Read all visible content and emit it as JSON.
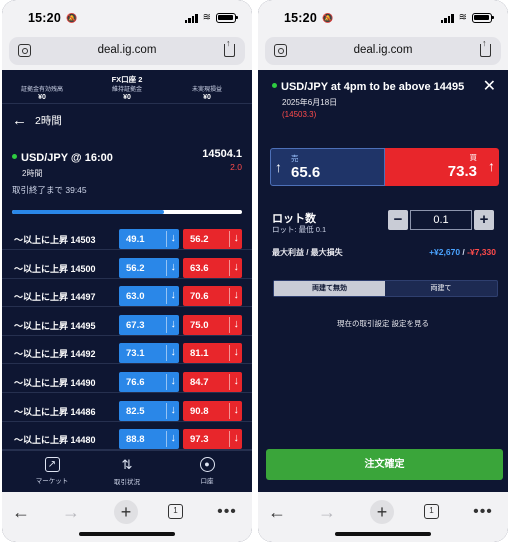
{
  "status": {
    "time": "15:20"
  },
  "browser": {
    "url": "deal.ig.com"
  },
  "account": {
    "title": "FX口座 2",
    "cols": [
      {
        "label": "証拠金有効残高",
        "value": "¥0"
      },
      {
        "label": "維持証拠金",
        "value": "¥0"
      },
      {
        "label": "未実現損益",
        "value": "¥0"
      }
    ]
  },
  "left": {
    "subheader": "2時間",
    "market": {
      "name": "USD/JPY @ 16:00",
      "duration": "2時間",
      "price": "14504.1",
      "change": "2.0"
    },
    "countdown": "取引終了まで 39:45",
    "progress": 0.66,
    "rows": [
      {
        "label": "〜以上に上昇 14503",
        "sell": "49.1",
        "buy": "56.2"
      },
      {
        "label": "〜以上に上昇 14500",
        "sell": "56.2",
        "buy": "63.6"
      },
      {
        "label": "〜以上に上昇 14497",
        "sell": "63.0",
        "buy": "70.6"
      },
      {
        "label": "〜以上に上昇 14495",
        "sell": "67.3",
        "buy": "75.0"
      },
      {
        "label": "〜以上に上昇 14492",
        "sell": "73.1",
        "buy": "81.1"
      },
      {
        "label": "〜以上に上昇 14490",
        "sell": "76.6",
        "buy": "84.7"
      },
      {
        "label": "〜以上に上昇 14486",
        "sell": "82.5",
        "buy": "90.8"
      },
      {
        "label": "〜以上に上昇 14480",
        "sell": "88.8",
        "buy": "97.3"
      }
    ],
    "tabs": [
      {
        "label": "マーケット",
        "icon": "chart-icon"
      },
      {
        "label": "取引状況",
        "icon": "transfer-icon"
      },
      {
        "label": "口座",
        "icon": "account-icon"
      }
    ]
  },
  "right": {
    "title": "USD/JPY at 4pm to be above 14495",
    "date": "2025年6月18日",
    "level": "(14503.3)",
    "sell_label": "売",
    "sell_price": "65.6",
    "buy_label": "買",
    "buy_price": "73.3",
    "lot_label": "ロット数",
    "lot_min": "ロット: 最低 0.1",
    "lot_value": "0.1",
    "pl_label": "最大利益 / 最大損失",
    "max_profit": "+¥2,670",
    "pl_sep": " / ",
    "max_loss": "-¥7,330",
    "toggle_a": "両建て無効",
    "toggle_b": "両建て",
    "settings_text": "現在の取引設定 設定を見る",
    "confirm_label": "注文確定"
  },
  "colors": {
    "bg": "#0e1632",
    "sell": "#2a87e8",
    "buy": "#e8262b",
    "confirm": "#3aa53a"
  }
}
